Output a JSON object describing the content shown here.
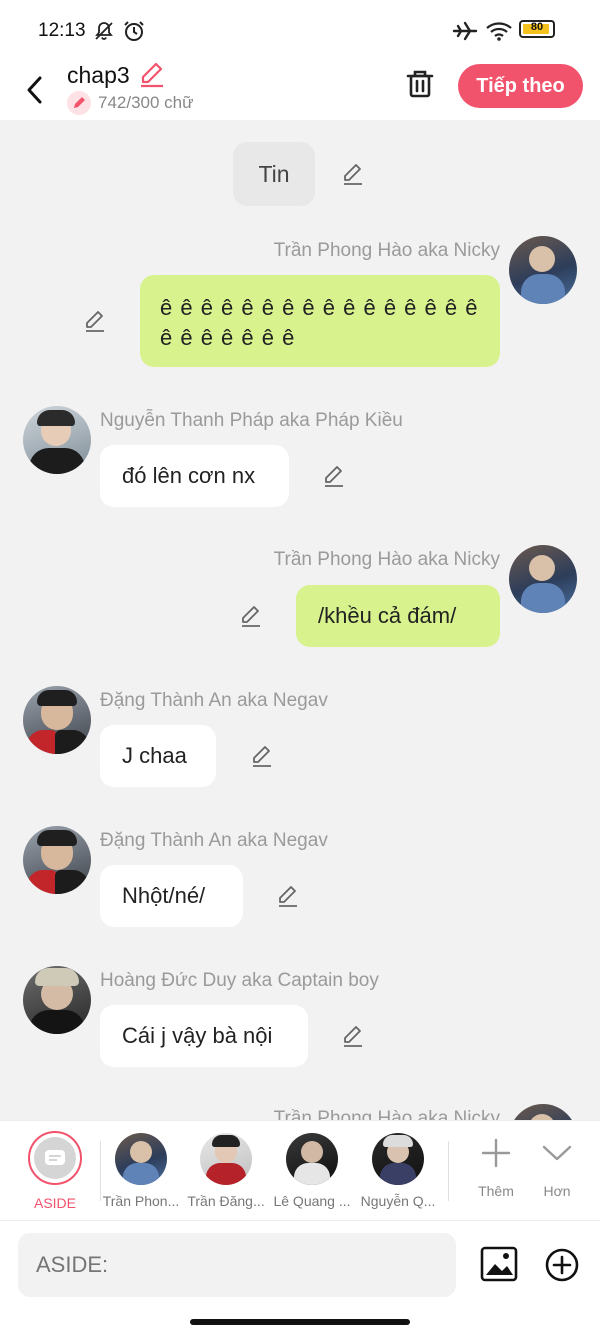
{
  "status_bar": {
    "time": "12:13",
    "battery": "80"
  },
  "header": {
    "title": "chap3",
    "word_count": "742/300 chữ",
    "next_label": "Tiếp theo",
    "accent": "#f2536c"
  },
  "chat": {
    "messages": [
      {
        "type": "aside",
        "text": "Tin"
      },
      {
        "type": "right",
        "name": "Trần Phong Hào aka Nicky",
        "text": "ê ê ê ê ê ê ê ê ê ê ê ê ê ê ê ê ê ê ê ê ê ê ê"
      },
      {
        "type": "left",
        "name": "Nguyễn Thanh Pháp aka Pháp Kiều",
        "text": "đó lên cơn nx"
      },
      {
        "type": "right",
        "name": "Trần Phong Hào aka Nicky",
        "text": "/khều cả đám/"
      },
      {
        "type": "left",
        "name": "Đặng Thành An aka Negav",
        "text": "J chaa"
      },
      {
        "type": "left",
        "name": "Đặng Thành An aka Negav",
        "text": "Nhột/né/"
      },
      {
        "type": "left",
        "name": "Hoàng Đức Duy aka Captain boy",
        "text": "Cái j vậy bà nội"
      },
      {
        "type": "right",
        "name": "Trần Phong Hào aka Nicky",
        "text": ""
      }
    ]
  },
  "characters": {
    "aside_label": "ASIDE",
    "items": [
      {
        "label": "Trần Phon..."
      },
      {
        "label": "Trần Đăng..."
      },
      {
        "label": "Lê Quang ..."
      },
      {
        "label": "Nguyễn Q..."
      }
    ],
    "more_label": "Thêm",
    "expand_label": "Hơn"
  },
  "input": {
    "placeholder": "ASIDE:"
  }
}
